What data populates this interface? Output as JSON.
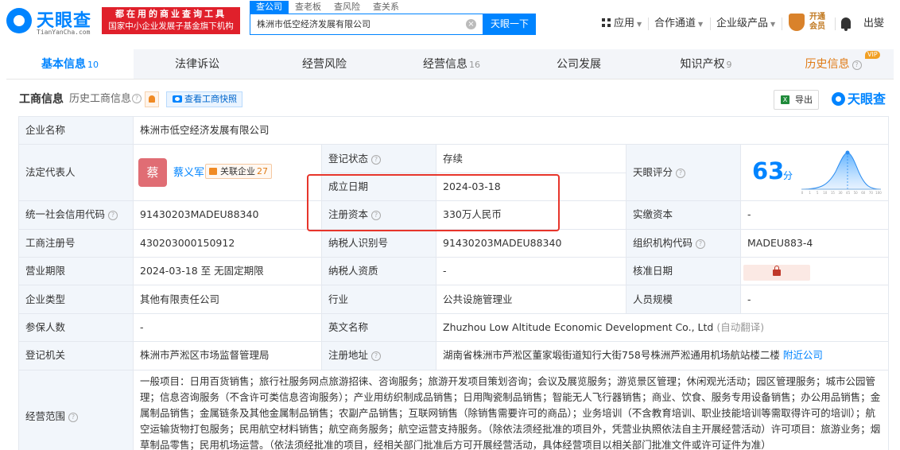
{
  "brand": {
    "name": "天眼查",
    "domain": "TianYanCha.com",
    "banner_line1": "都在用的商业查询工具",
    "banner_line2": "国家中小企业发展子基金旗下机构"
  },
  "search": {
    "tabs": [
      "查公司",
      "查老板",
      "查风险",
      "查关系"
    ],
    "value": "株洲市低空经济发展有限公司",
    "button": "天眼一下",
    "clear": "×"
  },
  "topnav": {
    "apps": "应用",
    "partner": "合作通道",
    "enterprise": "企业级产品",
    "vip_line1": "开通",
    "vip_line2": "会员",
    "user": "出燮"
  },
  "tabs": [
    {
      "label": "基本信息",
      "count": "10"
    },
    {
      "label": "法律诉讼",
      "count": ""
    },
    {
      "label": "经营风险",
      "count": ""
    },
    {
      "label": "经营信息",
      "count": "16"
    },
    {
      "label": "公司发展",
      "count": ""
    },
    {
      "label": "知识产权",
      "count": "9"
    },
    {
      "label": "历史信息",
      "count": "",
      "badge": "VIP"
    }
  ],
  "section": {
    "title": "工商信息",
    "history": "历史工商信息",
    "snapshot": "查看工商快照",
    "export": "导出",
    "excel": "X",
    "brand": "天眼查"
  },
  "info": {
    "company_name_label": "企业名称",
    "company_name": "株洲市低空经济发展有限公司",
    "legal_rep_label": "法定代表人",
    "legal_rep_avatar": "蔡",
    "legal_rep": "蔡义军",
    "related_label": "关联企业",
    "related_count": "27",
    "reg_status_label": "登记状态",
    "reg_status": "存续",
    "score_label": "天眼评分",
    "score": "63",
    "score_unit": "分",
    "score_ticks": [
      "0",
      "1",
      "5",
      "10",
      "15",
      "30",
      "45",
      "50",
      "60",
      "70",
      "100"
    ],
    "found_date_label": "成立日期",
    "found_date": "2024-03-18",
    "reg_capital_label": "注册资本",
    "reg_capital": "330万人民币",
    "paid_capital_label": "实缴资本",
    "paid_capital": "-",
    "credit_code_label": "统一社会信用代码",
    "credit_code": "91430203MADEU88340",
    "biz_reg_no_label": "工商注册号",
    "biz_reg_no": "430203000150912",
    "taxpayer_id_label": "纳税人识别号",
    "taxpayer_id": "91430203MADEU88340",
    "org_code_label": "组织机构代码",
    "org_code": "MADEU883-4",
    "term_label": "营业期限",
    "term": "2024-03-18 至 无固定期限",
    "taxpayer_qual_label": "纳税人资质",
    "taxpayer_qual": "-",
    "approve_date_label": "核准日期",
    "type_label": "企业类型",
    "type": "其他有限责任公司",
    "industry_label": "行业",
    "industry": "公共设施管理业",
    "staff_label": "人员规模",
    "staff": "-",
    "insured_label": "参保人数",
    "insured": "-",
    "en_name_label": "英文名称",
    "en_name": "Zhuzhou Low Altitude Economic Development Co., Ltd",
    "auto_translate": "(自动翻译)",
    "authority_label": "登记机关",
    "authority": "株洲市芦淞区市场监督管理局",
    "address_label": "注册地址",
    "address": "湖南省株洲市芦淞区董家塅街道知行大街758号株洲芦淞通用机场航站楼二楼",
    "nearby": "附近公司",
    "scope_label": "经营范围",
    "scope": "一般项目：日用百货销售；旅行社服务网点旅游招徕、咨询服务；旅游开发项目策划咨询；会议及展览服务；游览景区管理；休闲观光活动；园区管理服务；城市公园管理；信息咨询服务（不含许可类信息咨询服务）；产业用纺织制成品销售；日用陶瓷制品销售；智能无人飞行器销售；商业、饮食、服务专用设备销售；办公用品销售；金属制品销售；金属链条及其他金属制品销售；农副产品销售；互联网销售（除销售需要许可的商品）；业务培训（不含教育培训、职业技能培训等需取得许可的培训）；航空运输货物打包服务；民用航空材料销售；航空商务服务；航空运营支持服务。（除依法须经批准的项目外，凭营业执照依法自主开展经营活动）许可项目：旅游业务；烟草制品零售；民用机场运营。（依法须经批准的项目，经相关部门批准后方可开展经营活动，具体经营项目以相关部门批准文件或许可证件为准）"
  },
  "colors": {
    "accent": "#0084ff",
    "highlight_box": "#e7352b",
    "status_ok": "#1aa063"
  }
}
